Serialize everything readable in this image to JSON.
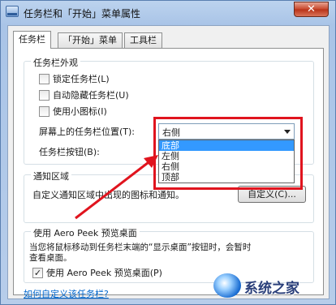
{
  "window": {
    "title": "任务栏和「开始」菜单属性",
    "close_glyph": "✕"
  },
  "tabs": [
    {
      "label": "任务栏",
      "active": true
    },
    {
      "label": "「开始」菜单",
      "active": false
    },
    {
      "label": "工具栏",
      "active": false
    }
  ],
  "appearance": {
    "title": "任务栏外观",
    "lock_label": "锁定任务栏(L)",
    "autohide_label": "自动隐藏任务栏(U)",
    "small_icons_label": "使用小图标(I)",
    "position_label": "屏幕上的任务栏位置(T):",
    "position_value": "右侧",
    "position_options": [
      "底部",
      "左侧",
      "右侧",
      "顶部"
    ],
    "highlighted_option": "底部",
    "buttons_label": "任务栏按钮(B):"
  },
  "notification": {
    "title": "通知区域",
    "description": "自定义通知区域中出现的图标和通知。",
    "customize_button": "自定义(C)..."
  },
  "aero_peek": {
    "title": "使用 Aero Peek 预览桌面",
    "description_line1": "当您将鼠标移动到任务栏末端的“显示桌面”按钮时，会暂时",
    "description_line2": "查看桌面。",
    "checkbox_label": "使用 Aero Peek 预览桌面(P)",
    "checked": true,
    "check_glyph": "✓"
  },
  "help_link": "如何自定义该任务栏?",
  "watermark": {
    "text": "系统之家"
  },
  "colors": {
    "annotation_red": "#e0141e",
    "selection_blue": "#3399ff",
    "link_blue": "#0066cc"
  }
}
